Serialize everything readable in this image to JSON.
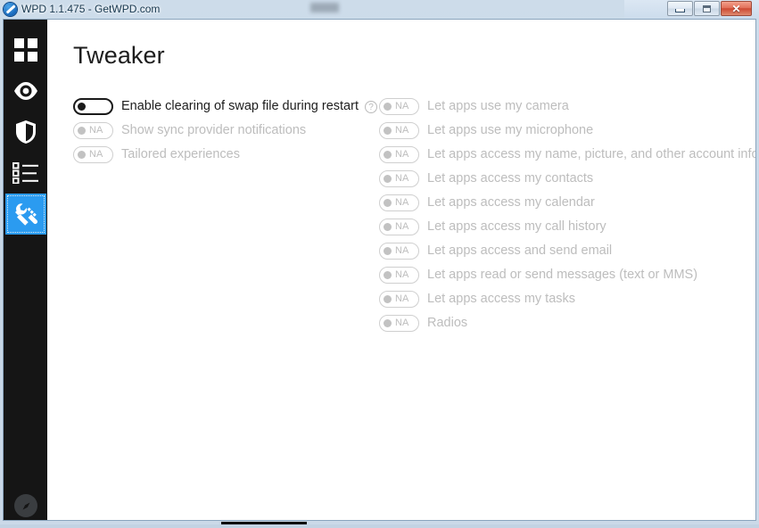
{
  "window": {
    "title": "WPD 1.1.475 - GetWPD.com",
    "logo_icon": "wpd-logo-icon",
    "controls": {
      "minimize_label": "–",
      "maximize_label": "□",
      "close_label": "✕"
    }
  },
  "sidebar": {
    "items": [
      {
        "name": "dashboard",
        "icon": "grid-icon",
        "active": false
      },
      {
        "name": "privacy",
        "icon": "eye-icon",
        "active": false
      },
      {
        "name": "defender",
        "icon": "shield-icon",
        "active": false
      },
      {
        "name": "rules",
        "icon": "list-icon",
        "active": false
      },
      {
        "name": "tweaker",
        "icon": "wrench-tools-icon",
        "active": true
      }
    ],
    "bottom_item": {
      "name": "about",
      "icon": "compass-icon"
    },
    "active_color": "#2b9bf0",
    "background_color": "#151515"
  },
  "main": {
    "title": "Tweaker",
    "left_column": [
      {
        "label": "Enable clearing of swap file during restart",
        "toggle_type": "switch",
        "state": "off",
        "has_help": true,
        "help_icon": "question-circle-icon"
      },
      {
        "label": "Show sync provider notifications",
        "toggle_type": "na",
        "na_text": "NA",
        "state": "disabled",
        "has_help": false
      },
      {
        "label": "Tailored experiences",
        "toggle_type": "na",
        "na_text": "NA",
        "state": "disabled",
        "has_help": false
      }
    ],
    "right_column": [
      {
        "label": "Let apps use my camera",
        "toggle_type": "na",
        "na_text": "NA",
        "state": "disabled"
      },
      {
        "label": "Let apps use my microphone",
        "toggle_type": "na",
        "na_text": "NA",
        "state": "disabled"
      },
      {
        "label": "Let apps access my name, picture, and other account info",
        "toggle_type": "na",
        "na_text": "NA",
        "state": "disabled"
      },
      {
        "label": "Let apps access my contacts",
        "toggle_type": "na",
        "na_text": "NA",
        "state": "disabled"
      },
      {
        "label": "Let apps access my calendar",
        "toggle_type": "na",
        "na_text": "NA",
        "state": "disabled"
      },
      {
        "label": "Let apps access my call history",
        "toggle_type": "na",
        "na_text": "NA",
        "state": "disabled"
      },
      {
        "label": "Let apps access and send email",
        "toggle_type": "na",
        "na_text": "NA",
        "state": "disabled"
      },
      {
        "label": "Let apps read or send messages (text or MMS)",
        "toggle_type": "na",
        "na_text": "NA",
        "state": "disabled"
      },
      {
        "label": "Let apps access my tasks",
        "toggle_type": "na",
        "na_text": "NA",
        "state": "disabled"
      },
      {
        "label": "Radios",
        "toggle_type": "na",
        "na_text": "NA",
        "state": "disabled"
      }
    ]
  }
}
